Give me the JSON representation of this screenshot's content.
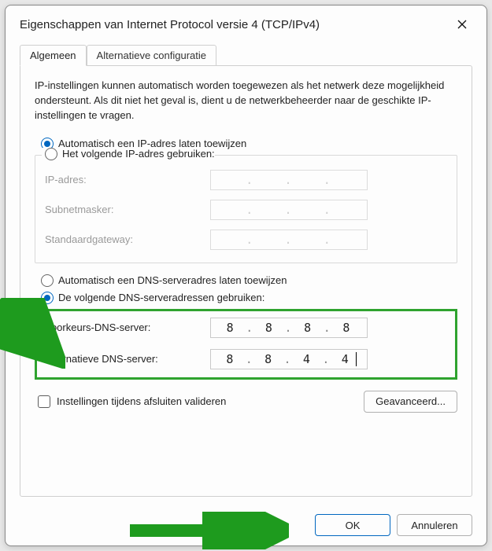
{
  "window": {
    "title": "Eigenschappen van Internet Protocol versie 4 (TCP/IPv4)"
  },
  "tabs": {
    "general": "Algemeen",
    "alt": "Alternatieve configuratie"
  },
  "intro": "IP-instellingen kunnen automatisch worden toegewezen als het netwerk deze mogelijkheid ondersteunt. Als dit niet het geval is, dient u de netwerkbeheerder naar de geschikte IP-instellingen te vragen.",
  "ip_section": {
    "auto_label": "Automatisch een IP-adres laten toewijzen",
    "manual_label": "Het volgende IP-adres gebruiken:",
    "auto_selected": true,
    "fields": {
      "ip": {
        "label": "IP-adres:",
        "value": [
          "",
          "",
          "",
          ""
        ]
      },
      "mask": {
        "label": "Subnetmasker:",
        "value": [
          "",
          "",
          "",
          ""
        ]
      },
      "gw": {
        "label": "Standaardgateway:",
        "value": [
          "",
          "",
          "",
          ""
        ]
      }
    }
  },
  "dns_section": {
    "auto_label": "Automatisch een DNS-serveradres laten toewijzen",
    "manual_label": "De volgende DNS-serveradressen gebruiken:",
    "manual_selected": true,
    "fields": {
      "pref": {
        "label": "Voorkeurs-DNS-server:",
        "value": [
          "8",
          "8",
          "8",
          "8"
        ]
      },
      "alt": {
        "label": "Alternatieve DNS-server:",
        "value": [
          "8",
          "8",
          "4",
          "4"
        ]
      }
    }
  },
  "validate_checkbox": "Instellingen tijdens afsluiten valideren",
  "advanced_btn": "Geavanceerd...",
  "ok_btn": "OK",
  "cancel_btn": "Annuleren"
}
